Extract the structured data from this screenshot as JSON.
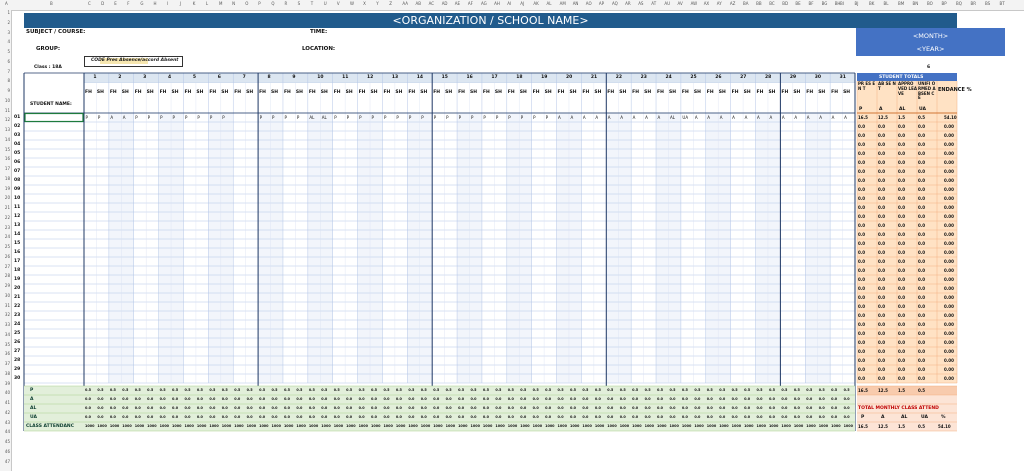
{
  "column_letters": [
    "A",
    "B",
    "C",
    "D",
    "E",
    "F",
    "G",
    "H",
    "I",
    "J",
    "K",
    "L",
    "M",
    "N",
    "O",
    "P",
    "Q",
    "R",
    "S",
    "T",
    "U",
    "V",
    "W",
    "X",
    "Y",
    "Z",
    "AA",
    "AB",
    "AC",
    "AD",
    "AE",
    "AF",
    "AG",
    "AH",
    "AI",
    "AJ",
    "AK",
    "AL",
    "AM",
    "AN",
    "AO",
    "AP",
    "AQ",
    "AR",
    "AS",
    "AT",
    "AU",
    "AV",
    "AW",
    "AX",
    "AY",
    "AZ",
    "BA",
    "BB",
    "BC",
    "BD",
    "BE",
    "BF",
    "BG",
    "BH",
    "BI",
    "BJ",
    "BK",
    "BL",
    "BM",
    "BN",
    "BO",
    "BP",
    "BQ",
    "BR",
    "BS",
    "BT"
  ],
  "row_numbers": [
    "1",
    "2",
    "3",
    "4",
    "5",
    "6",
    "7",
    "8",
    "9",
    "10",
    "11",
    "12",
    "13",
    "14",
    "15",
    "16",
    "17",
    "18",
    "19",
    "20",
    "21",
    "22",
    "23",
    "24",
    "25",
    "26",
    "27",
    "28",
    "29",
    "30",
    "31",
    "32",
    "33",
    "34",
    "35",
    "36",
    "37",
    "38",
    "39",
    "40",
    "41",
    "42",
    "43",
    "44",
    "45",
    "46",
    "47"
  ],
  "header": {
    "title": "<ORGANIZATION / SCHOOL NAME>",
    "subject_label": "SUBJECT / COURSE:",
    "time_label": "TIME:",
    "group_label": "GROUP:",
    "location_label": "LOCATION:",
    "class_label": "Class : 18A",
    "code_text": "CODE Pres Absence/accord Absent",
    "month": "<MONTH>",
    "year": "<YEAR>",
    "count": "6"
  },
  "days": [
    "1",
    "2",
    "3",
    "4",
    "5",
    "6",
    "7",
    "8",
    "9",
    "10",
    "11",
    "12",
    "13",
    "14",
    "15",
    "16",
    "17",
    "18",
    "19",
    "20",
    "21",
    "22",
    "23",
    "24",
    "25",
    "26",
    "27",
    "28",
    "29",
    "30",
    "31"
  ],
  "session_labels": [
    "FH",
    "SH"
  ],
  "student_name_label": "STUDENT NAME:",
  "totals": {
    "title": "STUDENT TOTALS",
    "col_labels": [
      "PR ES EN T",
      "AB SE NT",
      "APPRO VED LEAVE",
      "UNIFI ORMED ABSEN CE",
      "ENDANCE %"
    ],
    "col_codes": [
      "P",
      "A",
      "AL",
      "UA",
      ""
    ]
  },
  "student_rows": [
    "01",
    "02",
    "03",
    "04",
    "05",
    "06",
    "07",
    "08",
    "09",
    "10",
    "11",
    "12",
    "13",
    "14",
    "15",
    "16",
    "17",
    "18",
    "19",
    "20",
    "21",
    "22",
    "23",
    "24",
    "25",
    "26",
    "27",
    "28",
    "29",
    "30"
  ],
  "first_row_marks": [
    "P",
    "P",
    "A",
    "A",
    "P",
    "P",
    "P",
    "P",
    "P",
    "P",
    "P",
    "P",
    "",
    "",
    "P",
    "P",
    "P",
    "P",
    "AL",
    "AL",
    "P",
    "P",
    "P",
    "P",
    "P",
    "P",
    "P",
    "P",
    "P",
    "P",
    "P",
    "P",
    "P",
    "P",
    "P",
    "P",
    "P",
    "P",
    "A",
    "A",
    "A",
    "A",
    "A",
    "A",
    "A",
    "A",
    "A",
    "AL",
    "UA",
    "A",
    "A",
    "A",
    "A",
    "A",
    "A",
    "A",
    "A",
    "A",
    "A",
    "A",
    "A",
    "A"
  ],
  "first_row_totals": [
    "16.5",
    "12.5",
    "1.5",
    "0.5",
    "54.10"
  ],
  "other_row_totals": [
    "0.0",
    "0.0",
    "0.0",
    "0.0",
    "0.00"
  ],
  "summary_rows": [
    {
      "label": "P",
      "value": "0.5"
    },
    {
      "label": "A",
      "value": "0.0"
    },
    {
      "label": "AL",
      "value": "0.0"
    },
    {
      "label": "UA",
      "value": "0.0"
    },
    {
      "label": "CLASS ATTENDANC",
      "value": "1000"
    }
  ],
  "monthly": {
    "first_totals": [
      "16.5",
      "12.5",
      "1.5",
      "0.5"
    ],
    "title": "TOTAL MONTHLY CLASS ATTEND",
    "codes": [
      "P",
      "A",
      "AL",
      "UA",
      "%"
    ],
    "values": [
      "16.5",
      "12.5",
      "1.5",
      "0.5",
      "54.10"
    ]
  },
  "colors": {
    "title_bar": "#215b8c",
    "month_box": "#4472c4",
    "totals_header": "#4472c4",
    "totals_fill": "#ffe2c4",
    "summary_fill": "#e2efda",
    "grid_line": "#b4c6e7",
    "heavy_line": "#1f3864"
  }
}
